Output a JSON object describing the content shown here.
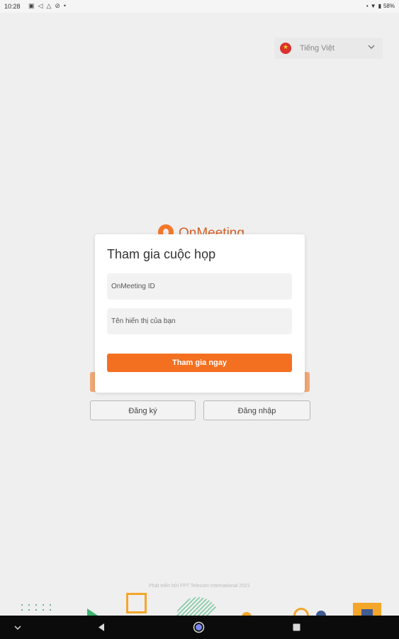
{
  "status_bar": {
    "time": "10:28",
    "battery": "58%",
    "left_icons": [
      "gallery-icon",
      "share-icon",
      "warning-icon",
      "no-sim-icon",
      "dot-icon"
    ],
    "right_icons": [
      "dot-icon",
      "wifi-icon",
      "battery-icon"
    ]
  },
  "language_selector": {
    "label": "Tiếng Việt",
    "flag": "vietnam-flag-icon"
  },
  "background": {
    "logo_text": "OnMeeting",
    "signup_label": "Đăng ký",
    "login_label": "Đăng nhập"
  },
  "dialog": {
    "title": "Tham gia cuộc họp",
    "meeting_id_placeholder": "OnMeeting ID",
    "display_name_placeholder": "Tên hiển thị của bạn",
    "join_label": "Tham gia ngay"
  },
  "footer": {
    "text": "Phát triển bởi FPT Telecom International 2021"
  },
  "nav_bar": {
    "icons": [
      "chevron-down-icon",
      "back-icon",
      "home-icon",
      "recents-icon"
    ]
  },
  "colors": {
    "accent": "#f47021",
    "background": "#efefef",
    "dialog": "#ffffff"
  }
}
